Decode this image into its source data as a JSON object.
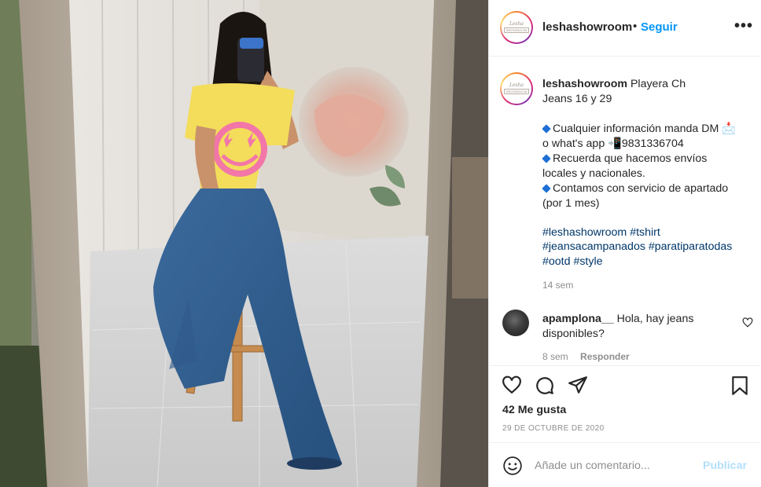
{
  "post": {
    "username": "leshashowroom",
    "follow_label": "Seguir",
    "dot": "•",
    "more_label": "•••",
    "avatar_logo_line1": "Lesha",
    "avatar_logo_line2": "SHOWROOM"
  },
  "caption": {
    "username": "leshashowroom",
    "line1_rest": " Playera Ch",
    "line2": "Jeans 16 y 29",
    "info1": "Cualquier información manda DM 📩",
    "info2": "o what's app 📲9831336704",
    "info3": "Recuerda que hacemos envíos",
    "info4": "locales y nacionales.",
    "info5": "Contamos con servicio de apartado",
    "info6": "(por 1 mes)",
    "hashtags_line1": "#leshashowroom #tshirt",
    "hashtags_line2": "#jeansacampanados #paratiparatodas",
    "hashtags_line3": "#ootd #style",
    "time": "14 sem"
  },
  "comment": {
    "username": "apamplona__",
    "text_line1": " Hola, hay jeans",
    "text_line2": "disponibles?",
    "time": "8 sem",
    "reply_label": "Responder"
  },
  "actions": {
    "icons": [
      "heart-icon",
      "comment-icon",
      "share-icon",
      "bookmark-icon"
    ],
    "likes": "42 Me gusta",
    "date": "29 DE OCTUBRE DE 2020"
  },
  "comment_box": {
    "placeholder": "Añade un comentario...",
    "publish_label": "Publicar"
  },
  "colors": {
    "link_blue": "#0095f6",
    "hashtag": "#00376b",
    "muted": "#8e8e8e",
    "publish_disabled": "#b2dffc"
  }
}
